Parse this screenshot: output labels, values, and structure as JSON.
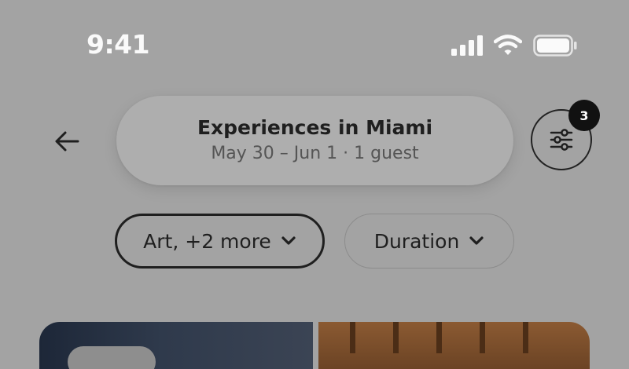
{
  "status_bar": {
    "time": "9:41",
    "icons": [
      "cellular-signal-icon",
      "wifi-icon",
      "battery-icon"
    ]
  },
  "header": {
    "back_icon": "arrow-left-icon",
    "search_title": "Experiences in Miami",
    "search_subtitle": "May 30 – Jun 1 · 1 guest",
    "filters_icon": "sliders-icon",
    "filters_badge": "3"
  },
  "chips": [
    {
      "label": "Art, +2 more",
      "icon": "chevron-down-icon",
      "selected": true
    },
    {
      "label": "Duration",
      "icon": "chevron-down-icon",
      "selected": false
    }
  ],
  "colors": {
    "overlay_background": "#a3a3a3",
    "pill_background": "#aeaeae",
    "text_primary": "#1f1f1f",
    "badge_background": "#111111"
  }
}
